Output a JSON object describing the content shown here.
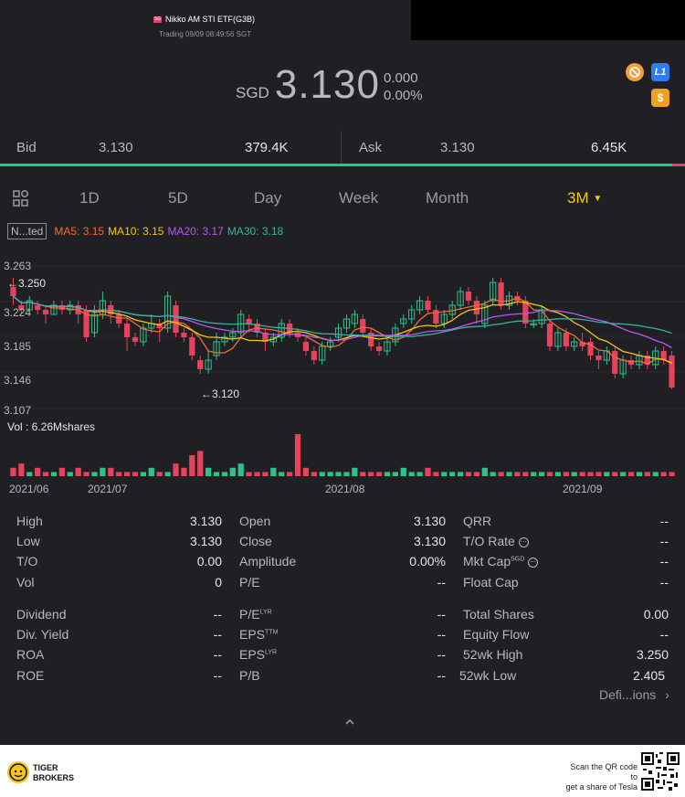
{
  "header": {
    "badge": "SG",
    "title": "Nikko AM STI ETF(G3B)",
    "subtitle": "Trading 09/09 08:49:56 SGT"
  },
  "quote": {
    "currency": "SGD",
    "price": "3.130",
    "change": "0.000",
    "change_pct": "0.00%"
  },
  "icons": {
    "icon1": "no-symbol-icon",
    "icon2_label": "L1",
    "icon3_label": "$"
  },
  "bidask": {
    "bid_label": "Bid",
    "bid_price": "3.130",
    "bid_size": "379.4K",
    "ask_label": "Ask",
    "ask_price": "3.130",
    "ask_size": "6.45K"
  },
  "tabs": [
    "1D",
    "5D",
    "Day",
    "Week",
    "Month",
    "3M"
  ],
  "ma": {
    "tag": "N...ted",
    "ma5": "MA5: 3.15",
    "ma10": "MA10: 3.15",
    "ma20": "MA20: 3.17",
    "ma30": "MA30: 3.18",
    "colors": {
      "ma5": "#f06a3a",
      "ma10": "#f5c518",
      "ma20": "#b45cf0",
      "ma30": "#3ab0a0"
    }
  },
  "axis": {
    "y_ticks": [
      "3.263",
      "3.224",
      "3.185",
      "3.146",
      "3.107"
    ],
    "high_mark": "←3.250",
    "low_mark": "←3.120",
    "vol_label": "Vol  : 6.26Mshares",
    "dates": [
      "2021/06",
      "2021/07",
      "2021/08",
      "2021/09"
    ]
  },
  "chart_data": {
    "type": "candlestick",
    "ylim": [
      3.107,
      3.263
    ],
    "candles": [
      [
        3.24,
        3.23,
        3.25,
        3.22
      ],
      [
        3.22,
        3.215,
        3.225,
        3.21
      ],
      [
        3.215,
        3.225,
        3.23,
        3.21
      ],
      [
        3.22,
        3.215,
        3.225,
        3.21
      ],
      [
        3.215,
        3.21,
        3.22,
        3.2
      ],
      [
        3.21,
        3.22,
        3.225,
        3.21
      ],
      [
        3.22,
        3.215,
        3.225,
        3.21
      ],
      [
        3.215,
        3.22,
        3.225,
        3.21
      ],
      [
        3.22,
        3.21,
        3.225,
        3.2
      ],
      [
        3.215,
        3.185,
        3.22,
        3.18
      ],
      [
        3.19,
        3.21,
        3.22,
        3.185
      ],
      [
        3.21,
        3.225,
        3.235,
        3.205
      ],
      [
        3.22,
        3.21,
        3.225,
        3.2
      ],
      [
        3.21,
        3.2,
        3.215,
        3.195
      ],
      [
        3.2,
        3.185,
        3.205,
        3.17
      ],
      [
        3.185,
        3.18,
        3.19,
        3.175
      ],
      [
        3.18,
        3.195,
        3.2,
        3.175
      ],
      [
        3.195,
        3.2,
        3.21,
        3.19
      ],
      [
        3.2,
        3.195,
        3.205,
        3.18
      ],
      [
        3.195,
        3.23,
        3.235,
        3.19
      ],
      [
        3.22,
        3.19,
        3.225,
        3.185
      ],
      [
        3.19,
        3.185,
        3.195,
        3.18
      ],
      [
        3.185,
        3.165,
        3.19,
        3.16
      ],
      [
        3.16,
        3.15,
        3.165,
        3.145
      ],
      [
        3.15,
        3.16,
        3.17,
        3.145
      ],
      [
        3.165,
        3.18,
        3.19,
        3.16
      ],
      [
        3.18,
        3.185,
        3.19,
        3.175
      ],
      [
        3.185,
        3.19,
        3.195,
        3.18
      ],
      [
        3.19,
        3.21,
        3.215,
        3.185
      ],
      [
        3.205,
        3.2,
        3.21,
        3.19
      ],
      [
        3.2,
        3.19,
        3.205,
        3.185
      ],
      [
        3.19,
        3.18,
        3.195,
        3.17
      ],
      [
        3.18,
        3.185,
        3.19,
        3.175
      ],
      [
        3.185,
        3.2,
        3.205,
        3.18
      ],
      [
        3.2,
        3.19,
        3.205,
        3.185
      ],
      [
        3.19,
        3.185,
        3.195,
        3.18
      ],
      [
        3.18,
        3.17,
        3.185,
        3.165
      ],
      [
        3.17,
        3.16,
        3.175,
        3.155
      ],
      [
        3.16,
        3.175,
        3.18,
        3.155
      ],
      [
        3.175,
        3.18,
        3.185,
        3.17
      ],
      [
        3.185,
        3.195,
        3.2,
        3.18
      ],
      [
        3.195,
        3.205,
        3.21,
        3.19
      ],
      [
        3.2,
        3.21,
        3.215,
        3.195
      ],
      [
        3.205,
        3.19,
        3.21,
        3.185
      ],
      [
        3.19,
        3.175,
        3.195,
        3.17
      ],
      [
        3.175,
        3.17,
        3.18,
        3.165
      ],
      [
        3.17,
        3.18,
        3.185,
        3.165
      ],
      [
        3.18,
        3.195,
        3.2,
        3.175
      ],
      [
        3.2,
        3.205,
        3.21,
        3.195
      ],
      [
        3.205,
        3.215,
        3.22,
        3.2
      ],
      [
        3.215,
        3.225,
        3.23,
        3.21
      ],
      [
        3.225,
        3.215,
        3.23,
        3.21
      ],
      [
        3.215,
        3.2,
        3.22,
        3.195
      ],
      [
        3.2,
        3.21,
        3.215,
        3.195
      ],
      [
        3.21,
        3.22,
        3.225,
        3.205
      ],
      [
        3.22,
        3.235,
        3.24,
        3.215
      ],
      [
        3.235,
        3.225,
        3.24,
        3.22
      ],
      [
        3.225,
        3.21,
        3.23,
        3.2
      ],
      [
        3.2,
        3.22,
        3.225,
        3.195
      ],
      [
        3.225,
        3.245,
        3.25,
        3.22
      ],
      [
        3.245,
        3.22,
        3.25,
        3.215
      ],
      [
        3.22,
        3.23,
        3.235,
        3.215
      ],
      [
        3.23,
        3.225,
        3.235,
        3.22
      ],
      [
        3.225,
        3.2,
        3.23,
        3.195
      ],
      [
        3.2,
        3.2,
        3.205,
        3.195
      ],
      [
        3.2,
        3.215,
        3.22,
        3.195
      ],
      [
        3.2,
        3.175,
        3.205,
        3.17
      ],
      [
        3.175,
        3.19,
        3.195,
        3.17
      ],
      [
        3.19,
        3.175,
        3.195,
        3.17
      ],
      [
        3.175,
        3.18,
        3.185,
        3.17
      ],
      [
        3.18,
        3.175,
        3.19,
        3.17
      ],
      [
        3.18,
        3.165,
        3.185,
        3.16
      ],
      [
        3.165,
        3.16,
        3.17,
        3.15
      ],
      [
        3.16,
        3.17,
        3.175,
        3.155
      ],
      [
        3.17,
        3.145,
        3.175,
        3.14
      ],
      [
        3.145,
        3.16,
        3.165,
        3.14
      ],
      [
        3.16,
        3.155,
        3.165,
        3.15
      ],
      [
        3.155,
        3.165,
        3.17,
        3.15
      ],
      [
        3.165,
        3.155,
        3.17,
        3.15
      ],
      [
        3.155,
        3.17,
        3.175,
        3.15
      ],
      [
        3.17,
        3.16,
        3.175,
        3.155
      ],
      [
        3.165,
        3.13,
        3.17,
        3.128
      ]
    ],
    "volume": [
      2,
      3,
      1,
      2,
      1,
      1,
      2,
      1,
      2,
      1,
      1,
      2,
      2,
      1,
      1,
      1,
      1,
      2,
      1,
      1,
      3,
      2,
      5,
      6,
      2,
      1,
      1,
      2,
      3,
      1,
      1,
      1,
      2,
      1,
      1,
      10,
      2,
      1,
      1,
      1,
      1,
      1,
      2,
      1,
      1,
      1,
      1,
      1,
      2,
      1,
      1,
      2,
      1,
      1,
      1,
      1,
      1,
      1,
      2,
      1,
      1,
      1,
      1,
      1,
      1,
      1,
      1,
      1,
      1,
      1,
      1,
      1,
      1,
      1,
      1,
      1,
      1,
      1,
      1,
      1,
      1,
      1
    ]
  },
  "stats": {
    "col1": [
      {
        "label": "High",
        "value": "3.130"
      },
      {
        "label": "Low",
        "value": "3.130"
      },
      {
        "label": "T/O",
        "value": "0.00"
      },
      {
        "label": "Vol",
        "value": "0"
      },
      {
        "label": "Dividend",
        "value": "--"
      },
      {
        "label": "Div. Yield",
        "value": "--"
      },
      {
        "label": "ROA",
        "value": "--"
      },
      {
        "label": "ROE",
        "value": "--"
      }
    ],
    "col2": [
      {
        "label": "Open",
        "value": "3.130"
      },
      {
        "label": "Close",
        "value": "3.130"
      },
      {
        "label": "Amplitude",
        "value": "0.00%"
      },
      {
        "label": "P/E",
        "value": "--"
      },
      {
        "label": "P/E",
        "sup": "LYR",
        "value": "--"
      },
      {
        "label": "EPS",
        "sup": "TTM",
        "value": "--"
      },
      {
        "label": "EPS",
        "sup": "LYR",
        "value": "--"
      },
      {
        "label": "P/B",
        "value": "--"
      }
    ],
    "col3": [
      {
        "label": "QRR",
        "value": "--"
      },
      {
        "label": "T/O Rate",
        "value": "--"
      },
      {
        "label": "Mkt Cap",
        "sup": "SGD",
        "value": "--"
      },
      {
        "label": "Float Cap",
        "value": "--"
      },
      {
        "label": "Total Shares",
        "value": "0.00"
      },
      {
        "label": "Equity Flow",
        "value": "--"
      },
      {
        "label": "52wk High",
        "value": "3.250"
      },
      {
        "label": "52wk Low",
        "value": "2.405"
      }
    ],
    "definitions": "Defi...ions"
  },
  "footer": {
    "brand_line1": "TIGER",
    "brand_line2": "BROKERS",
    "qr_line1": "Scan the QR code to",
    "qr_line2": "get a share of Tesla"
  }
}
